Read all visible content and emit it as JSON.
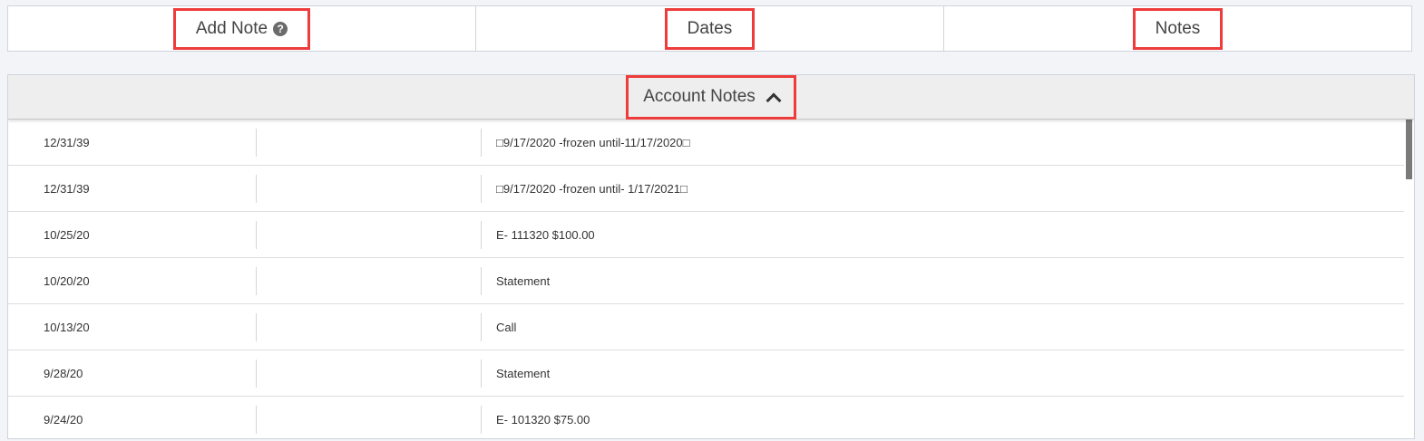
{
  "tabs": [
    {
      "label": "Add Note",
      "has_help_icon": true
    },
    {
      "label": "Dates"
    },
    {
      "label": "Notes"
    }
  ],
  "panel": {
    "title": "Account Notes",
    "rows": [
      {
        "date": "12/31/39",
        "note": "□9/17/2020 -frozen until-11/17/2020□"
      },
      {
        "date": "12/31/39",
        "note": "□9/17/2020 -frozen until- 1/17/2021□"
      },
      {
        "date": "10/25/20",
        "note": "E- 111320 $100.00"
      },
      {
        "date": "10/20/20",
        "note": "Statement"
      },
      {
        "date": "10/13/20",
        "note": "Call"
      },
      {
        "date": "9/28/20",
        "note": "Statement"
      },
      {
        "date": "9/24/20",
        "note": "E- 101320 $75.00"
      }
    ]
  },
  "colors": {
    "highlight": "#ee3b3b",
    "header_bg": "#eeeeee"
  },
  "icons": {
    "help": "question-circle-icon",
    "collapse": "chevron-up-icon"
  }
}
